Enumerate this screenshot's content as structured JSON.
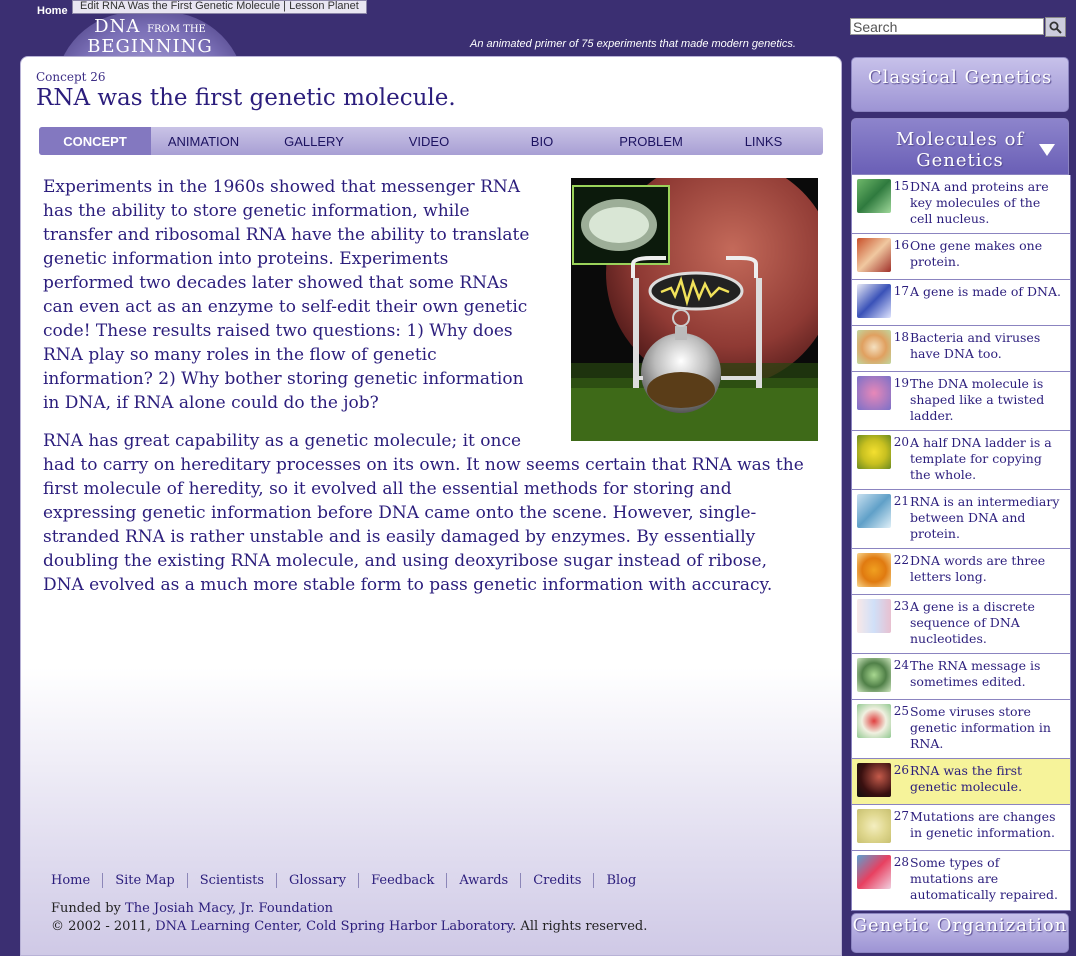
{
  "header": {
    "home_link": "Home",
    "tooltip": "Edit RNA Was the First Genetic Molecule | Lesson Planet",
    "logo_line1": "DNA",
    "logo_small": "FROM THE",
    "logo_line2": "BEGINNING",
    "tagline": "An animated primer of 75 experiments that made modern genetics.",
    "search_value": "Search"
  },
  "main": {
    "concept_number": "Concept 26",
    "title": "RNA was the first genetic molecule.",
    "tabs": [
      "CONCEPT",
      "ANIMATION",
      "GALLERY",
      "VIDEO",
      "BIO",
      "PROBLEM",
      "LINKS"
    ],
    "paragraph1": "Experiments in the 1960s showed that messenger RNA has the ability to store genetic information, while transfer and ribosomal RNA have the ability to translate genetic information into proteins. Experiments performed two decades later showed that some RNAs can even act as an enzyme to self-edit their own genetic code! These results raised two questions: 1) Why does RNA play so many roles in the flow of genetic information? 2) Why bother storing genetic information in DNA, if RNA alone could do the job?",
    "paragraph2": "RNA has great capability as a genetic molecule; it once had to carry on hereditary processes on its own. It now seems certain that RNA was the first molecule of heredity, so it evolved all the essential methods for storing and expressing genetic information before DNA came onto the scene. However, single-stranded RNA is rather unstable and is easily damaged by enzymes. By essentially doubling the existing RNA molecule, and using deoxyribose sugar instead of ribose, DNA evolved as a much more stable form to pass genetic information with accuracy."
  },
  "footer": {
    "links": [
      "Home",
      "Site Map",
      "Scientists",
      "Glossary",
      "Feedback",
      "Awards",
      "Credits",
      "Blog"
    ],
    "funded_prefix": "Funded by ",
    "funded_link": "The Josiah Macy, Jr. Foundation",
    "copyright_prefix": "© 2002 - 2011, ",
    "copyright_link": "DNA Learning Center, Cold Spring Harbor Laboratory",
    "copyright_suffix": ". All rights reserved."
  },
  "sidebar": {
    "section1": "Classical Genetics",
    "section2": "Molecules of Genetics",
    "section3": "Genetic Organization",
    "items": [
      {
        "num": "15",
        "text": "DNA and proteins are key molecules of the cell nucleus."
      },
      {
        "num": "16",
        "text": "One gene makes one protein."
      },
      {
        "num": "17",
        "text": "A gene is made of DNA."
      },
      {
        "num": "18",
        "text": "Bacteria and viruses have DNA too."
      },
      {
        "num": "19",
        "text": "The DNA molecule is shaped like a twisted ladder."
      },
      {
        "num": "20",
        "text": "A half DNA ladder is a template for copying the whole."
      },
      {
        "num": "21",
        "text": "RNA is an intermediary between DNA and protein."
      },
      {
        "num": "22",
        "text": "DNA words are three letters long."
      },
      {
        "num": "23",
        "text": "A gene is a discrete sequence of DNA nucleotides."
      },
      {
        "num": "24",
        "text": "The RNA message is sometimes edited."
      },
      {
        "num": "25",
        "text": "Some viruses store genetic information in RNA."
      },
      {
        "num": "26",
        "text": "RNA was the first genetic molecule."
      },
      {
        "num": "27",
        "text": "Mutations are changes in genetic information."
      },
      {
        "num": "28",
        "text": "Some types of mutations are automatically repaired."
      }
    ]
  }
}
